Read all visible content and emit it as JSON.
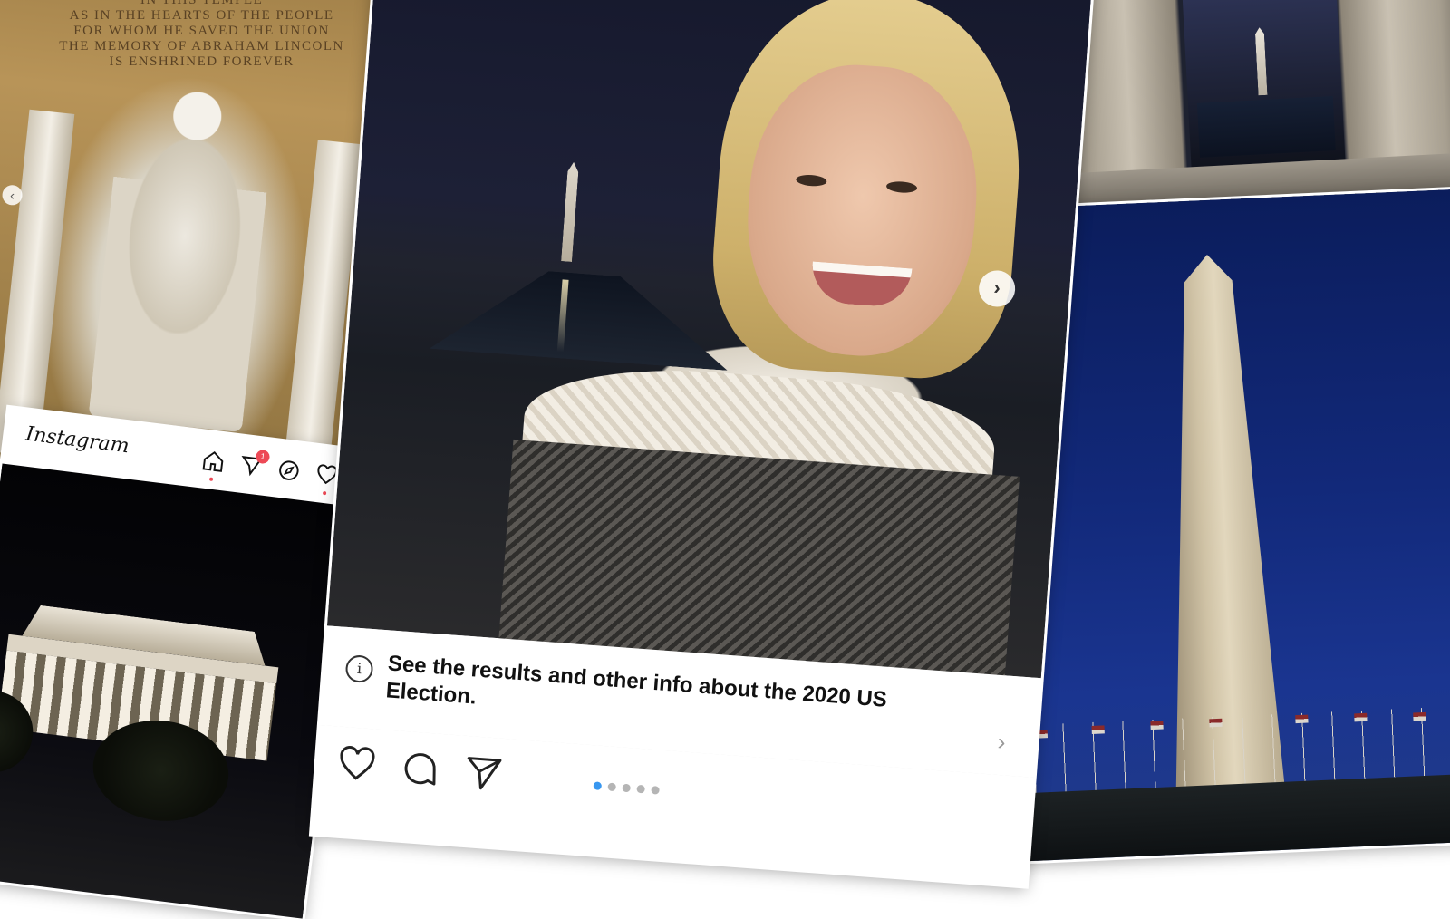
{
  "statue_panel": {
    "inscription": [
      "IN THIS TEMPLE",
      "AS IN THE HEARTS OF THE PEOPLE",
      "FOR WHOM HE SAVED THE UNION",
      "THE MEMORY OF ABRAHAM LINCOLN",
      "IS ENSHRINED FOREVER"
    ]
  },
  "small_post": {
    "logo": "Instagram",
    "header_icons": [
      "home-icon",
      "direct-message-icon",
      "explore-compass-icon",
      "activity-heart-icon"
    ],
    "notification_count": "1"
  },
  "main_post": {
    "info_banner": "See the results and other info about the 2020 US Election.",
    "action_icons": [
      "like-heart-icon",
      "comment-icon",
      "share-icon"
    ],
    "carousel_total": 5,
    "carousel_active": 1
  },
  "glyphs": {
    "next": "›",
    "prev": "‹",
    "info": "i",
    "chevron": "›"
  },
  "colors": {
    "badge": "#ed4956",
    "carousel_active_dot": "#3897f0"
  }
}
